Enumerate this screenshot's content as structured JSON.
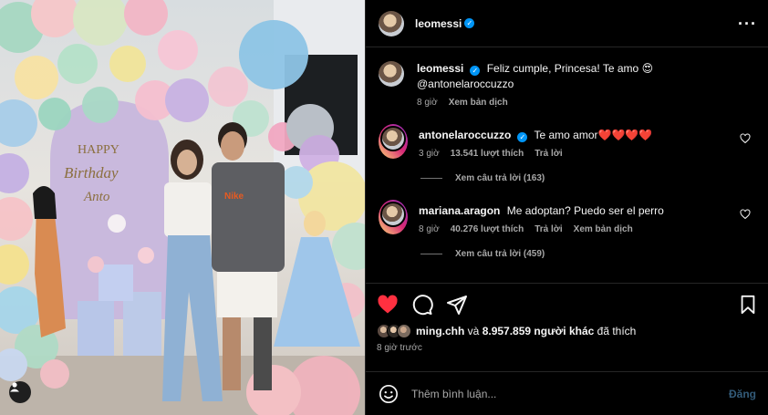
{
  "colors": {
    "background": "#000000",
    "link": "#0095f6",
    "like": "#ff3040",
    "muted": "#a8a8a8",
    "post_disabled": "#335b79"
  },
  "photo": {
    "banner_line1": "HAPPY",
    "banner_line2": "Birthday",
    "banner_line3": "Anto",
    "shirt_text": "Nike"
  },
  "header": {
    "username": "leomessi",
    "verified": true,
    "more_icon": "more-horizontal-icon"
  },
  "caption": {
    "username": "leomessi",
    "text": "Feliz cumple, Princesa! Te amo 😍 @antonelaroccuzzo",
    "time": "8 giờ",
    "translate": "Xem bản dịch"
  },
  "comments": [
    {
      "username": "antonelaroccuzzo",
      "text": "Te amo amor❤️❤️❤️❤️",
      "time": "3 giờ",
      "likes": "13.541 lượt thích",
      "reply": "Trả lời",
      "view_replies": "Xem câu trả lời (163)"
    },
    {
      "username": "mariana.aragon",
      "text": "Me adoptan? Puedo ser el perro",
      "time": "8 giờ",
      "likes": "40.276 lượt thích",
      "reply": "Trả lời",
      "translate": "Xem bản dịch",
      "view_replies": "Xem câu trả lời (459)"
    }
  ],
  "actions": {
    "like_icon": "heart-filled-icon",
    "comment_icon": "comment-icon",
    "share_icon": "share-icon",
    "save_icon": "bookmark-icon"
  },
  "likes": {
    "first_user": "ming.chh",
    "connector": " và ",
    "others": "8.957.859 người khác",
    "suffix": " đã thích"
  },
  "posted_ago": "8 giờ trước",
  "add_comment": {
    "placeholder": "Thêm bình luận...",
    "post_label": "Đăng",
    "emoji_icon": "smiley-icon"
  }
}
